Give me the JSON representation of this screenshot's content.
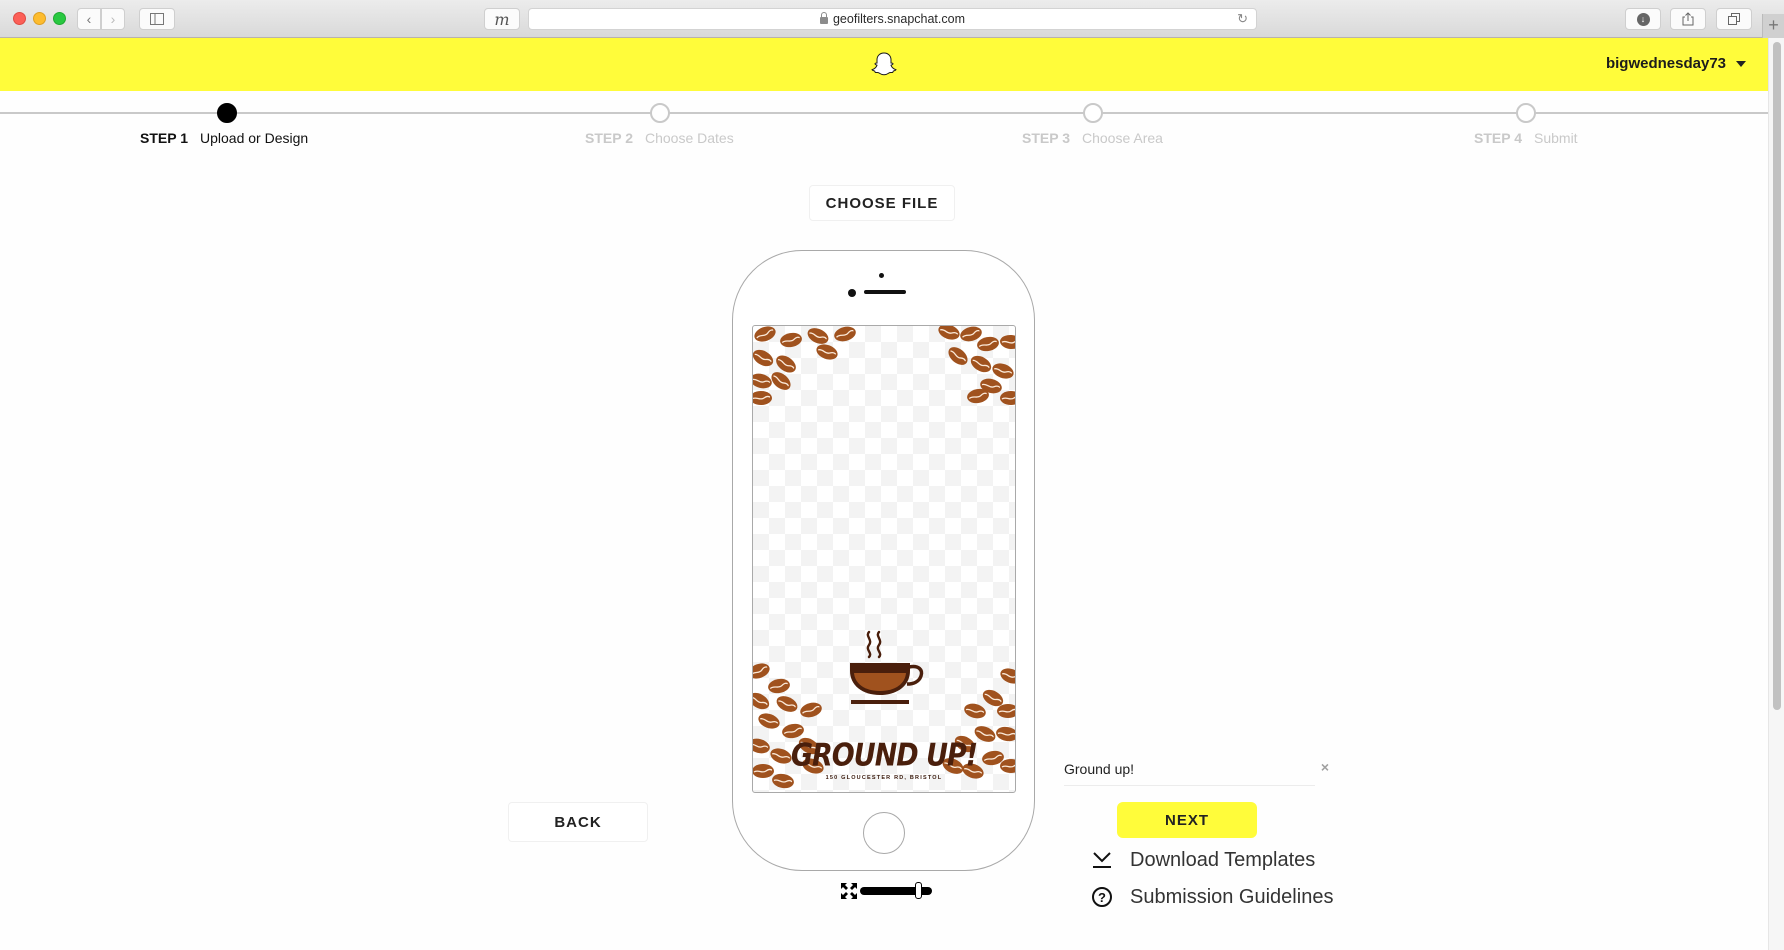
{
  "browser": {
    "url": "geofilters.snapchat.com",
    "m_button": "m",
    "new_tab": "+"
  },
  "header": {
    "logo": "snapchat-ghost",
    "username": "bigwednesday73"
  },
  "steps": [
    {
      "num": "STEP 1",
      "label": "Upload or Design",
      "active": true
    },
    {
      "num": "STEP 2",
      "label": "Choose Dates",
      "active": false
    },
    {
      "num": "STEP 3",
      "label": "Choose Area",
      "active": false
    },
    {
      "num": "STEP 4",
      "label": "Submit",
      "active": false
    }
  ],
  "upload": {
    "choose_file_label": "CHOOSE FILE"
  },
  "preview": {
    "filter_title": "GROUND UP!",
    "filter_address": "150 GLOUCESTER RD, BRISTOL",
    "accent_color": "#a0521e",
    "dark_color": "#4a1f0c",
    "zoom_level": 0.85
  },
  "caption": {
    "value": "Ground up!",
    "clear_label": "×"
  },
  "actions": {
    "back_label": "BACK",
    "next_label": "NEXT",
    "download_templates": "Download Templates",
    "submission_guidelines": "Submission Guidelines"
  },
  "colors": {
    "brand_yellow": "#fffc3a",
    "inactive_step": "#c9c9c9"
  }
}
